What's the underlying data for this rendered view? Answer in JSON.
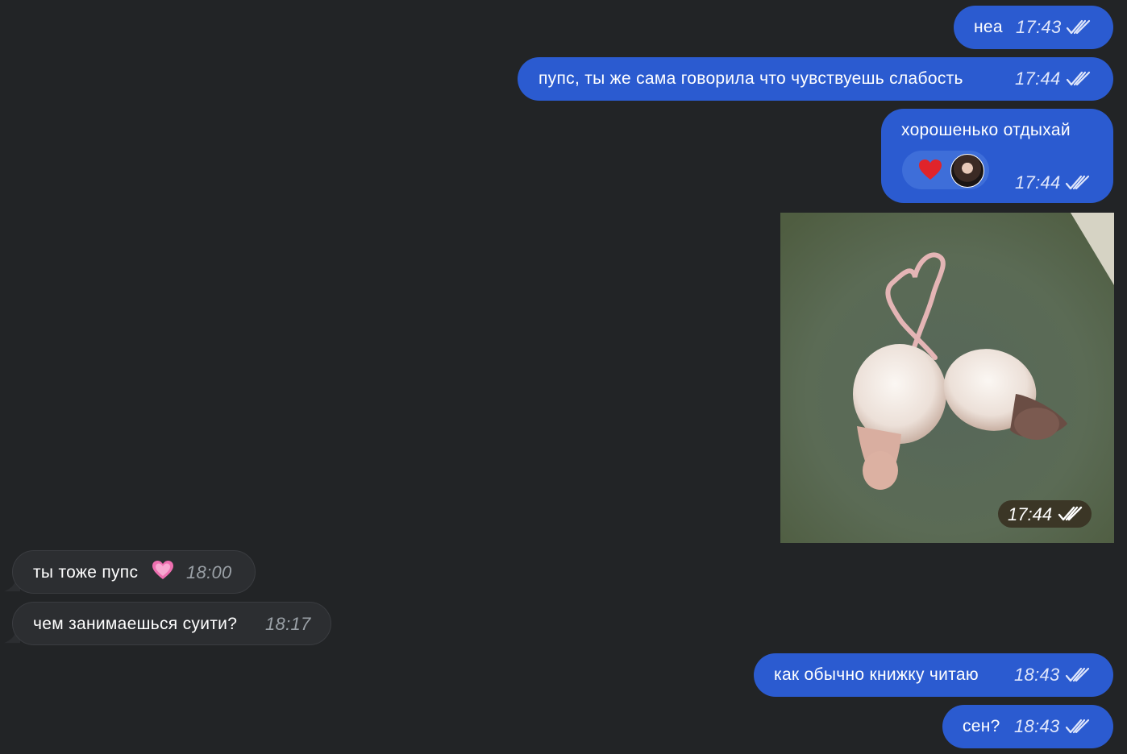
{
  "messages": [
    {
      "direction": "outgoing",
      "text": "неа",
      "time": "17:43",
      "status": "read"
    },
    {
      "direction": "outgoing",
      "text": "пупс, ты же сама говорила что чувствуешь слабость",
      "time": "17:44",
      "status": "read"
    },
    {
      "direction": "outgoing",
      "text": "хорошенько отдыхай",
      "time": "17:44",
      "status": "read",
      "reaction": {
        "emoji": "❤️",
        "avatar": "avatar"
      }
    },
    {
      "direction": "outgoing",
      "type": "photo",
      "time": "17:44",
      "status": "read"
    },
    {
      "direction": "incoming",
      "text": "ты тоже пупс",
      "emoji": "💗",
      "time": "18:00"
    },
    {
      "direction": "incoming",
      "text": "чем занимаешься суити?",
      "time": "18:17"
    },
    {
      "direction": "outgoing",
      "text": "как обычно книжку читаю",
      "time": "18:43",
      "status": "read"
    },
    {
      "direction": "outgoing",
      "text": "сен?",
      "time": "18:43",
      "status": "read"
    }
  ],
  "icons": {
    "read_status": "double-check-icon",
    "reaction": "heart-icon"
  },
  "colors": {
    "background": "#222426",
    "outgoing_bubble": "#2b5bd0",
    "incoming_bubble": "#2c2e31"
  }
}
